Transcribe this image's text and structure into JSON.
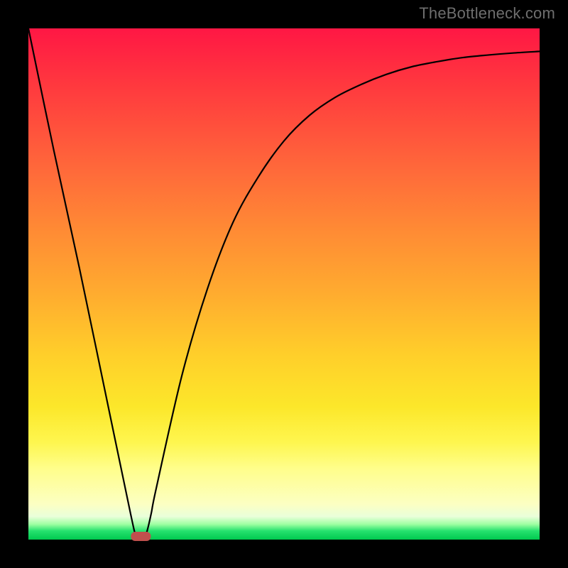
{
  "watermark": "TheBottleneck.com",
  "chart_data": {
    "type": "line",
    "title": "",
    "xlabel": "",
    "ylabel": "",
    "xlim": [
      0,
      100
    ],
    "ylim": [
      0,
      100
    ],
    "grid": false,
    "legend": false,
    "background_gradient": {
      "direction": "top-to-bottom",
      "stops": [
        {
          "pos": 0,
          "color": "#ff1744"
        },
        {
          "pos": 50,
          "color": "#ffac2f"
        },
        {
          "pos": 82,
          "color": "#fef64f"
        },
        {
          "pos": 95,
          "color": "#e9ffda"
        },
        {
          "pos": 100,
          "color": "#00c94f"
        }
      ]
    },
    "series": [
      {
        "name": "bottleneck-curve",
        "x": [
          0,
          5,
          10,
          15,
          20,
          21,
          22,
          23,
          24,
          25,
          30,
          35,
          40,
          45,
          50,
          55,
          60,
          65,
          70,
          75,
          80,
          85,
          90,
          95,
          100
        ],
        "values": [
          100,
          76,
          53,
          29,
          5,
          1,
          0,
          1,
          5,
          10,
          32,
          49,
          62,
          71,
          78,
          83,
          86.5,
          89,
          91,
          92.5,
          93.5,
          94.3,
          94.8,
          95.2,
          95.5
        ]
      }
    ],
    "annotations": [
      {
        "name": "minimum-marker",
        "x": 22,
        "y": 0,
        "shape": "rounded-rect",
        "color": "#c0504d"
      }
    ]
  }
}
